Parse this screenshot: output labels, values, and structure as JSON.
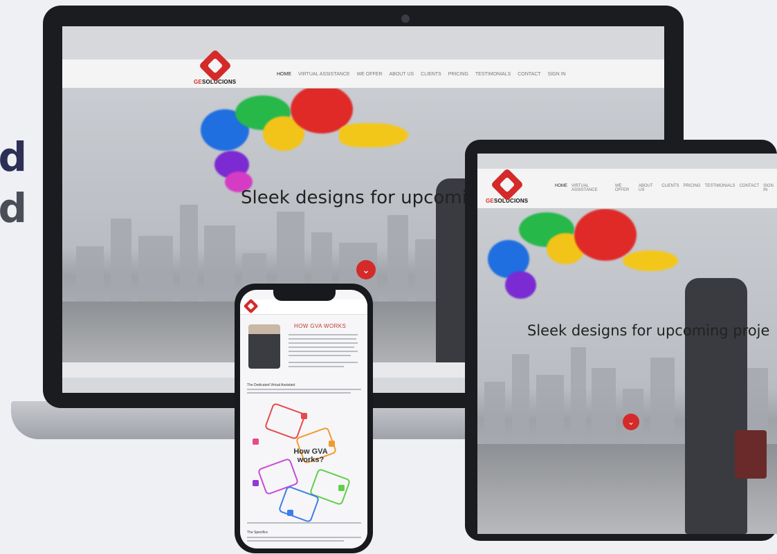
{
  "side_text": {
    "line1": "d",
    "line2": "d"
  },
  "site": {
    "logo": {
      "prefix": "GE",
      "name": "SOLUCIONS"
    },
    "nav": [
      "HOME",
      "VIRTUAL ASSISTANCE",
      "WE OFFER",
      "ABOUT US",
      "CLIENTS",
      "PRICING",
      "TESTIMONIALS",
      "CONTACT",
      "SIGN IN"
    ],
    "active_nav": "HOME",
    "hero_title_laptop": "Sleek designs for upcoming proj",
    "hero_title_tablet": "Sleek designs for upcoming proje",
    "down_icon": "chevron-down-icon"
  },
  "phone": {
    "page_title": "HOW GVA WORKS",
    "section_label": "The Dedicated Virtual Assistant",
    "center_label_line1": "How GVA",
    "center_label_line2": "works?",
    "footer_label": "The Specifics"
  },
  "colors": {
    "brand_red": "#d42a2a",
    "dark_navy": "#2d2f55",
    "device_frame": "#1b1c20"
  }
}
